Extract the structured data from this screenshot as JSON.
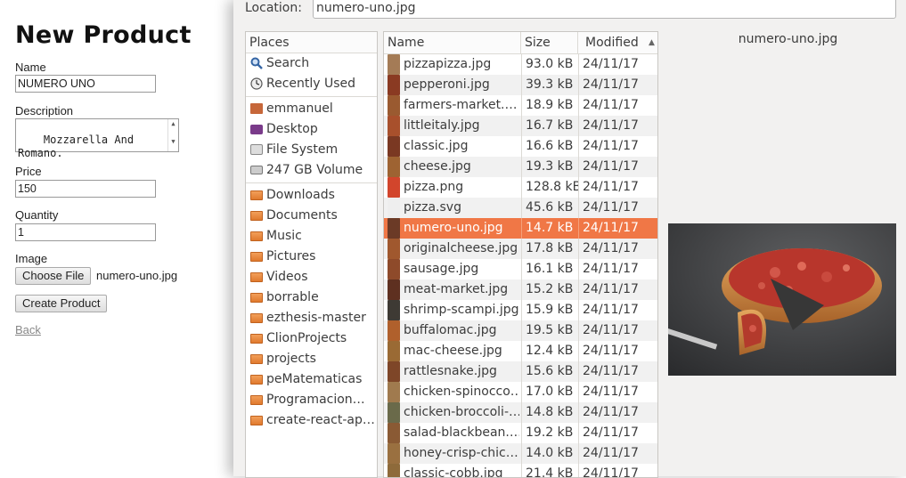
{
  "form": {
    "title": "New Product",
    "name_label": "Name",
    "name_value": "NUMERO UNO",
    "description_label": "Description",
    "description_value": "Mozzarella And\nRomano.",
    "price_label": "Price",
    "price_value": "150",
    "quantity_label": "Quantity",
    "quantity_value": "1",
    "image_label": "Image",
    "choose_file_label": "Choose File",
    "chosen_file": "numero-uno.jpg",
    "submit_label": "Create Product",
    "back_label": "Back"
  },
  "dialog": {
    "location_label": "Location:",
    "location_value": "numero-uno.jpg",
    "places_header": "Places",
    "places": [
      {
        "label": "Search",
        "icon": "search-icon"
      },
      {
        "label": "Recently Used",
        "icon": "clock-icon"
      },
      {
        "label": "emmanuel",
        "icon": "home-folder-icon"
      },
      {
        "label": "Desktop",
        "icon": "desktop-icon"
      },
      {
        "label": "File System",
        "icon": "filesystem-icon"
      },
      {
        "label": "247 GB Volume",
        "icon": "drive-icon"
      },
      {
        "label": "Downloads",
        "icon": "downloads-folder-icon"
      },
      {
        "label": "Documents",
        "icon": "documents-folder-icon"
      },
      {
        "label": "Music",
        "icon": "music-folder-icon"
      },
      {
        "label": "Pictures",
        "icon": "pictures-folder-icon"
      },
      {
        "label": "Videos",
        "icon": "videos-folder-icon"
      },
      {
        "label": "borrable",
        "icon": "folder-icon"
      },
      {
        "label": "ezthesis-master",
        "icon": "folder-icon"
      },
      {
        "label": "ClionProjects",
        "icon": "folder-icon"
      },
      {
        "label": "projects",
        "icon": "folder-icon"
      },
      {
        "label": "peMatematicas",
        "icon": "folder-icon"
      },
      {
        "label": "Programacion…",
        "icon": "folder-icon"
      },
      {
        "label": "create-react-ap…",
        "icon": "folder-icon"
      }
    ],
    "columns": {
      "name": "Name",
      "size": "Size",
      "modified": "Modified"
    },
    "files": [
      {
        "name": "pizzapizza.jpg",
        "size": "93.0 kB",
        "modified": "24/11/17",
        "color": "#a47b56"
      },
      {
        "name": "pepperoni.jpg",
        "size": "39.3 kB",
        "modified": "24/11/17",
        "color": "#8a3a22"
      },
      {
        "name": "farmers-market.…",
        "size": "18.9 kB",
        "modified": "24/11/17",
        "color": "#9a5a30"
      },
      {
        "name": "littleitaly.jpg",
        "size": "16.7 kB",
        "modified": "24/11/17",
        "color": "#a8502c"
      },
      {
        "name": "classic.jpg",
        "size": "16.6 kB",
        "modified": "24/11/17",
        "color": "#7a3822"
      },
      {
        "name": "cheese.jpg",
        "size": "19.3 kB",
        "modified": "24/11/17",
        "color": "#9e6332"
      },
      {
        "name": "pizza.png",
        "size": "128.8 kB",
        "modified": "24/11/17",
        "color": "#d2452c"
      },
      {
        "name": "pizza.svg",
        "size": "45.6 kB",
        "modified": "24/11/17",
        "color": "#eeeeee"
      },
      {
        "name": "numero-uno.jpg",
        "size": "14.7 kB",
        "modified": "24/11/17",
        "color": "#6b3a26",
        "selected": true
      },
      {
        "name": "originalcheese.jpg",
        "size": "17.8 kB",
        "modified": "24/11/17",
        "color": "#a0582e"
      },
      {
        "name": "sausage.jpg",
        "size": "16.1 kB",
        "modified": "24/11/17",
        "color": "#8e4a2a"
      },
      {
        "name": "meat-market.jpg",
        "size": "15.2 kB",
        "modified": "24/11/17",
        "color": "#5e3020"
      },
      {
        "name": "shrimp-scampi.jpg",
        "size": "15.9 kB",
        "modified": "24/11/17",
        "color": "#3e3a34"
      },
      {
        "name": "buffalomac.jpg",
        "size": "19.5 kB",
        "modified": "24/11/17",
        "color": "#b0602c"
      },
      {
        "name": "mac-cheese.jpg",
        "size": "12.4 kB",
        "modified": "24/11/17",
        "color": "#9a6a34"
      },
      {
        "name": "rattlesnake.jpg",
        "size": "15.6 kB",
        "modified": "24/11/17",
        "color": "#7e4628"
      },
      {
        "name": "chicken-spinocco…",
        "size": "17.0 kB",
        "modified": "24/11/17",
        "color": "#a07a4e"
      },
      {
        "name": "chicken-broccoli-…",
        "size": "14.8 kB",
        "modified": "24/11/17",
        "color": "#6a6a4a"
      },
      {
        "name": "salad-blackbean.…",
        "size": "19.2 kB",
        "modified": "24/11/17",
        "color": "#8a5a34"
      },
      {
        "name": "honey-crisp-chic…",
        "size": "14.0 kB",
        "modified": "24/11/17",
        "color": "#9a7040"
      },
      {
        "name": "classic-cobb.jpg",
        "size": "21.4 kB",
        "modified": "24/11/17",
        "color": "#8e6a3a"
      }
    ],
    "preview_filename": "numero-uno.jpg"
  }
}
